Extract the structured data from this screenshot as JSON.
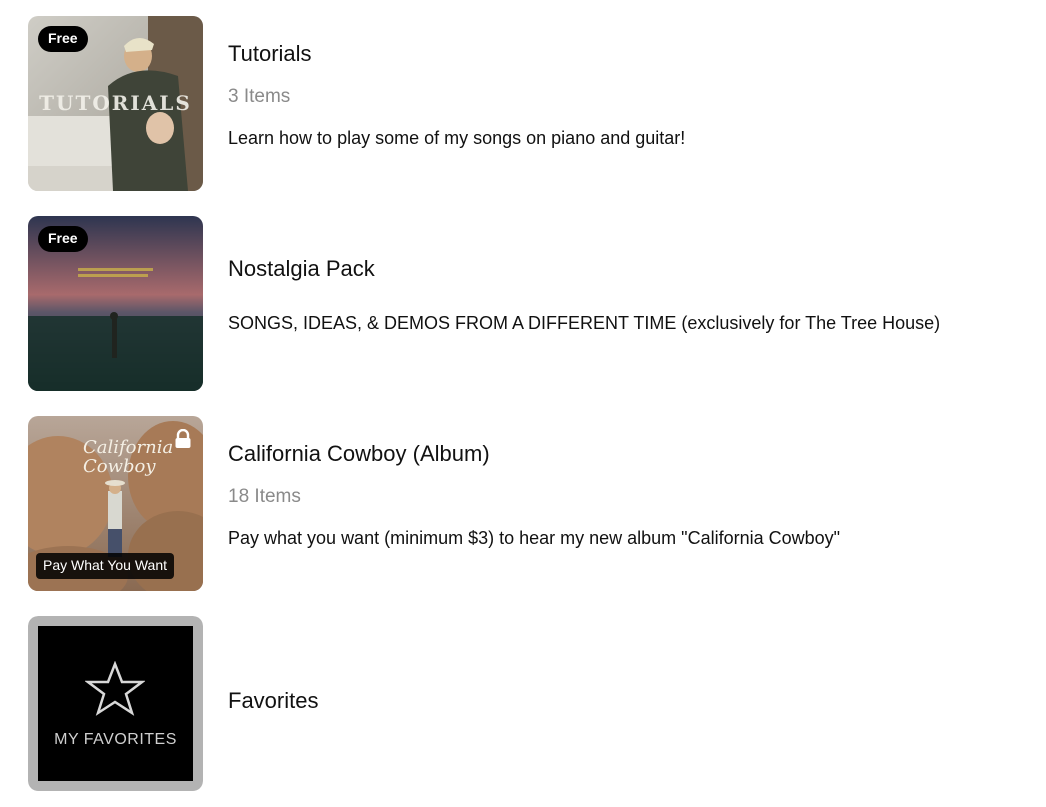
{
  "collections": [
    {
      "title": "Tutorials",
      "count": "3 Items",
      "description": "Learn how to play some of my songs on piano and guitar!",
      "badge": "Free",
      "thumb_text": "TUTORIALS"
    },
    {
      "title": "Nostalgia Pack",
      "description": "SONGS, IDEAS, & DEMOS FROM A DIFFERENT TIME (exclusively for The Tree House)",
      "badge": "Free"
    },
    {
      "title": "California Cowboy (Album)",
      "count": "18 Items",
      "description": "Pay what you want (minimum $3) to hear my new album \"California Cowboy\"",
      "badge": "Pay What You Want",
      "thumb_text": "California Cowboy",
      "locked_icon": "lock-icon"
    },
    {
      "title": "Favorites",
      "thumb_text": "MY FAVORITES",
      "icon": "star-icon"
    }
  ],
  "colors": {
    "badge_bg": "#000000",
    "count_text": "#8a8a8a",
    "favorites_frame": "#b3b3b3"
  }
}
